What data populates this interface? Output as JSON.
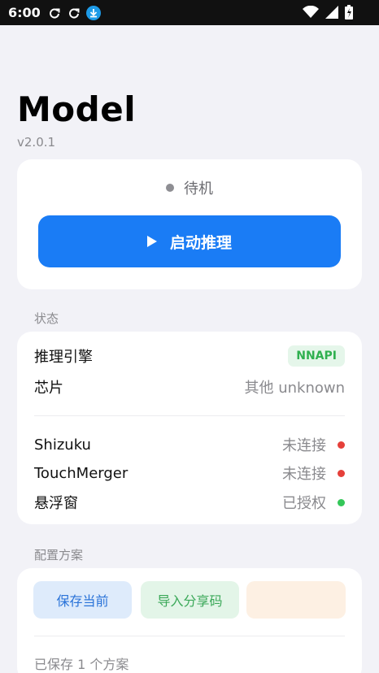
{
  "status_bar": {
    "time": "6:00",
    "icons": [
      "sync-icon",
      "sync-icon",
      "download-icon",
      "wifi-icon",
      "signal-icon",
      "battery-icon"
    ]
  },
  "app": {
    "title": "Model",
    "version": "v2.0.1"
  },
  "control": {
    "state_text": "待机",
    "start_label": "启动推理"
  },
  "status_section": {
    "label": "状态",
    "rows": [
      {
        "key": "推理引擎",
        "value": "NNAPI"
      },
      {
        "key": "芯片",
        "value": "其他 unknown"
      },
      {
        "key": "Shizuku",
        "value": "未连接",
        "dot_color": "#e5403a"
      },
      {
        "key": "TouchMerger",
        "value": "未连接",
        "dot_color": "#e5403a"
      },
      {
        "key": "悬浮窗",
        "value": "已授权",
        "dot_color": "#34c759"
      }
    ]
  },
  "config_section": {
    "label": "配置方案",
    "save_label": "保存当前",
    "import_label": "导入分享码",
    "saved_text": "已保存 1 个方案"
  },
  "colors": {
    "accent": "#1a7cf5",
    "success": "#34c759",
    "error": "#e5403a"
  }
}
